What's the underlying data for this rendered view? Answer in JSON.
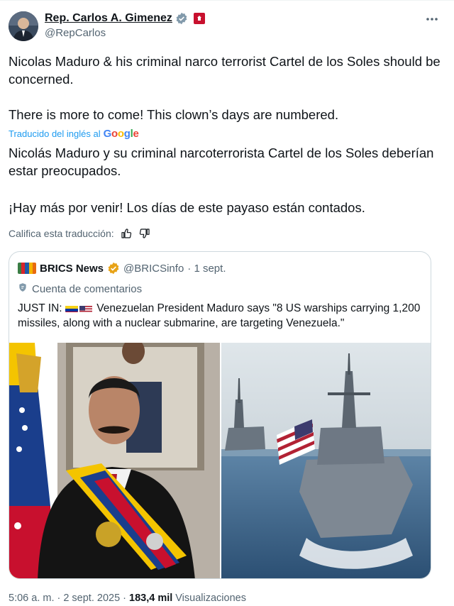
{
  "author": {
    "name": "Rep. Carlos A. Gimenez",
    "handle": "@RepCarlos",
    "verified_icon": "verified-badge-icon",
    "affiliation_icon": "government-badge-icon"
  },
  "tweet": {
    "text_en_p1": "Nicolas Maduro & his criminal narco terrorist Cartel de los Soles should be concerned.",
    "text_en_p2": "There is more to come! This clown’s days are numbered.",
    "translated_label": "Traducido del inglés al",
    "translated_provider": "Google",
    "text_es_p1": "Nicolás Maduro y su criminal narcoterrorista Cartel de los Soles deberían estar preocupados.",
    "text_es_p2": "¡Hay más por venir! Los días de este payaso están contados.",
    "rate_label": "Califica esta traducción:"
  },
  "quote": {
    "name": "BRICS News",
    "handle": "@BRICSinfo",
    "date": "· 1 sept.",
    "sub_label": "Cuenta de comentarios",
    "text_prefix": "JUST IN:",
    "text_body": "Venezuelan President Maduro says \"8 US warships carrying 1,200 missiles, along with a nuclear submarine, are targeting Venezuela.\""
  },
  "meta": {
    "time": "5:06 a. m.",
    "sep1": "·",
    "date": "2 sept. 2025",
    "sep2": "·",
    "views": "183,4 mil",
    "views_label": "Visualizaciones"
  },
  "colors": {
    "link_blue": "#1d9bf0",
    "muted": "#536471",
    "border": "#cfd9de",
    "verified_gold": "#e8a317"
  }
}
